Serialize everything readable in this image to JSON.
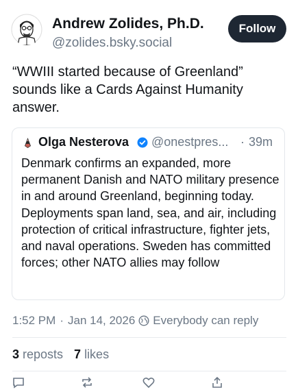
{
  "author": {
    "name": "Andrew Zolides, Ph.D.",
    "handle": "@zolides.bsky.social",
    "follow_label": "Follow"
  },
  "post": {
    "text": "“WWIII started because of Greenland” sounds like a Cards Against Humanity answer."
  },
  "quote": {
    "name": "Olga Nesterova",
    "handle": "@onestpres...",
    "dot": "·",
    "time": "39m",
    "text": "Denmark confirms an expanded, more permanent Danish and NATO military presence in and around Greenland, beginning today. Deployments span land, sea, and air, including protection of critical infrastructure, fighter jets, and naval operations. Sweden has committed forces; other NATO allies may follow"
  },
  "meta": {
    "time": "1:52 PM",
    "sep": "·",
    "date": "Jan 14, 2026",
    "reply_setting": "Everybody can reply"
  },
  "stats": {
    "reposts_count": "3",
    "reposts_label": "reposts",
    "likes_count": "7",
    "likes_label": "likes"
  },
  "colors": {
    "follow_bg": "#1e2733",
    "muted": "#6b7785",
    "verified": "#1083fe"
  },
  "icons": [
    "avatar-illustration",
    "flag-icon",
    "verified-badge-icon",
    "globe-icon",
    "reply-icon",
    "repost-icon",
    "like-icon",
    "share-icon"
  ]
}
